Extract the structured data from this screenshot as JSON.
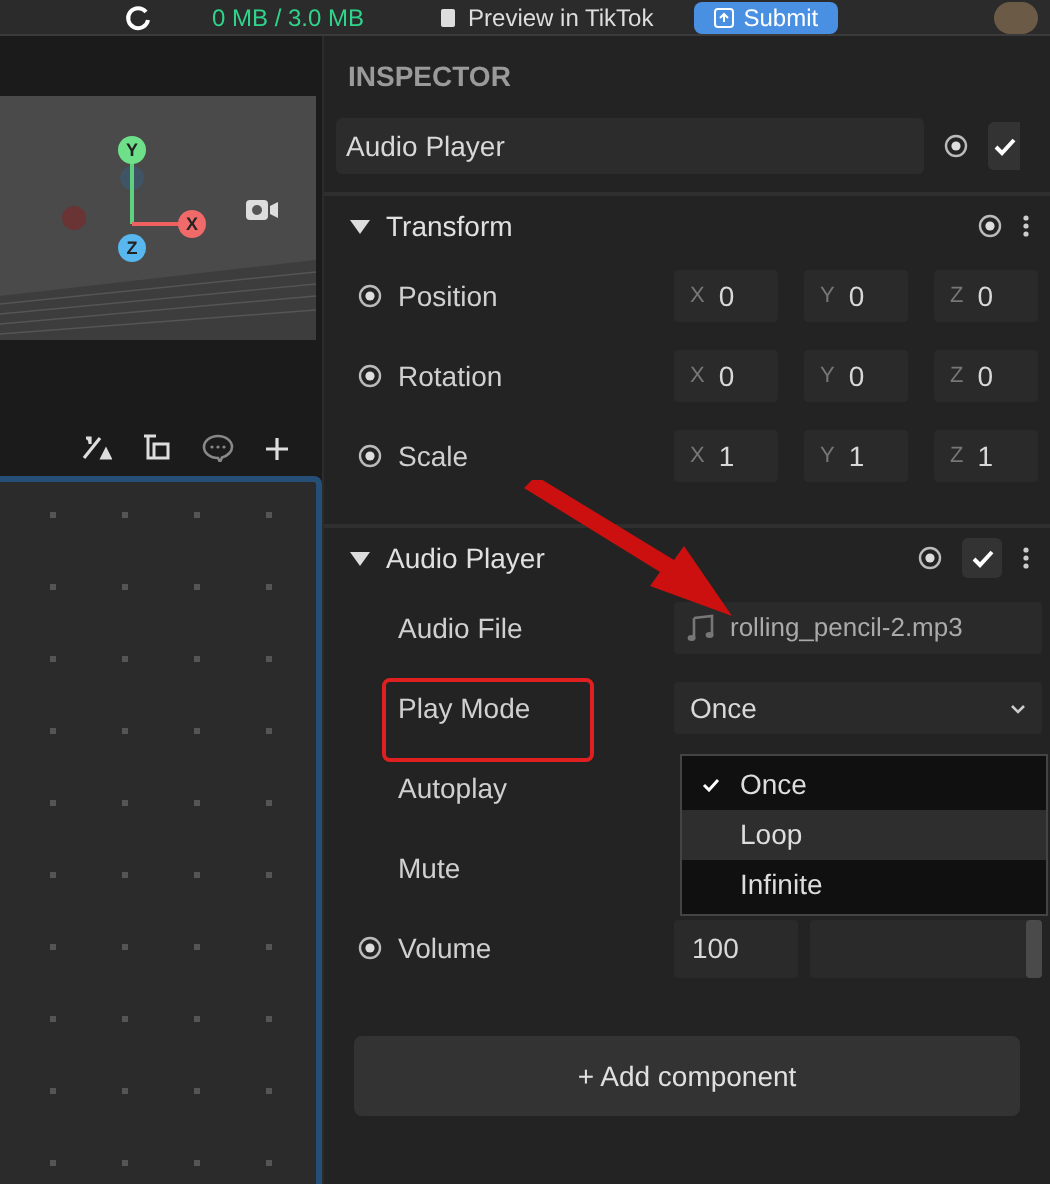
{
  "top_bar": {
    "memory": "0 MB / 3.0 MB",
    "preview_button": "Preview in TikTok",
    "submit_button": "Submit"
  },
  "scene_view": {
    "gizmo_axes": [
      "Y",
      "X",
      "Z"
    ]
  },
  "inspector": {
    "title": "INSPECTOR",
    "object_name": "Audio Player",
    "object_enabled": true,
    "components": [
      {
        "kind": "transform",
        "title": "Transform",
        "expanded": true,
        "rows": [
          {
            "label": "Position",
            "values": [
              {
                "axis": "X",
                "value": "0"
              },
              {
                "axis": "Y",
                "value": "0"
              },
              {
                "axis": "Z",
                "value": "0"
              }
            ]
          },
          {
            "label": "Rotation",
            "values": [
              {
                "axis": "X",
                "value": "0"
              },
              {
                "axis": "Y",
                "value": "0"
              },
              {
                "axis": "Z",
                "value": "0"
              }
            ]
          },
          {
            "label": "Scale",
            "values": [
              {
                "axis": "X",
                "value": "1"
              },
              {
                "axis": "Y",
                "value": "1"
              },
              {
                "axis": "Z",
                "value": "1"
              }
            ]
          }
        ]
      },
      {
        "kind": "audio",
        "title": "Audio Player",
        "expanded": true,
        "enabled": true,
        "audio_file_label": "Audio File",
        "audio_file": "rolling_pencil-2.mp3",
        "play_mode": {
          "label": "Play Mode",
          "value": "Once",
          "options": [
            {
              "label": "Once",
              "selected": true,
              "hovered": false
            },
            {
              "label": "Loop",
              "selected": false,
              "hovered": true
            },
            {
              "label": "Infinite",
              "selected": false,
              "hovered": false
            }
          ]
        },
        "autoplay_label": "Autoplay",
        "mute_label": "Mute",
        "volume": {
          "label": "Volume",
          "value": "100",
          "level": 1
        }
      }
    ],
    "add_component": "+ Add component"
  }
}
